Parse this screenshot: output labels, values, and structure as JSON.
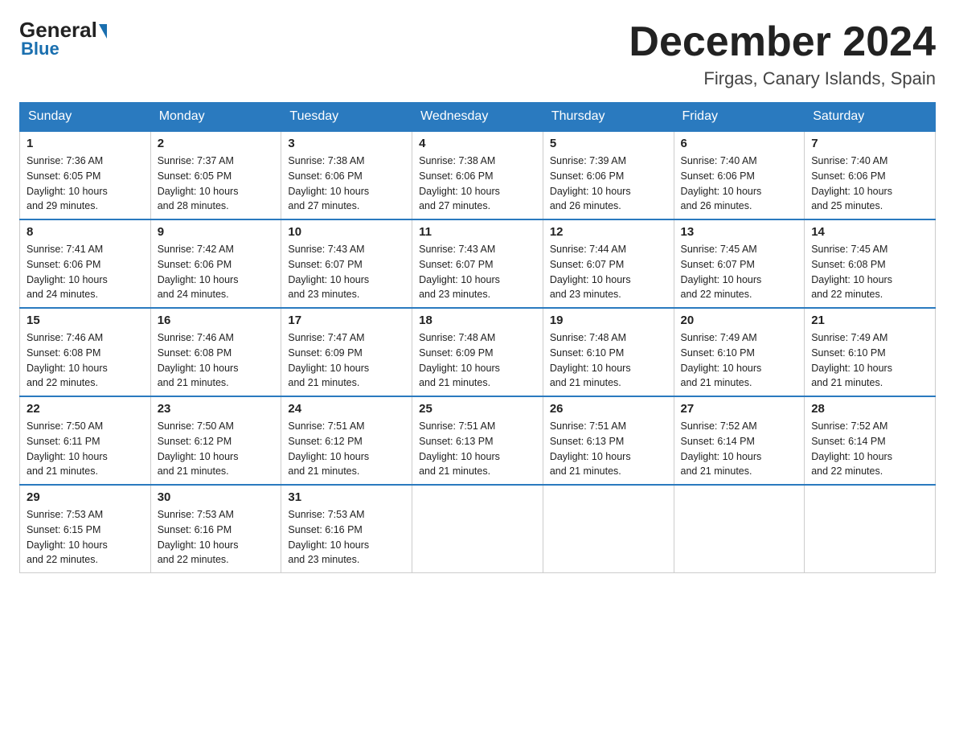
{
  "header": {
    "logo": {
      "general": "General",
      "blue": "Blue"
    },
    "title": "December 2024",
    "location": "Firgas, Canary Islands, Spain"
  },
  "days_of_week": [
    "Sunday",
    "Monday",
    "Tuesday",
    "Wednesday",
    "Thursday",
    "Friday",
    "Saturday"
  ],
  "weeks": [
    [
      {
        "day": "1",
        "sunrise": "7:36 AM",
        "sunset": "6:05 PM",
        "daylight": "10 hours and 29 minutes."
      },
      {
        "day": "2",
        "sunrise": "7:37 AM",
        "sunset": "6:05 PM",
        "daylight": "10 hours and 28 minutes."
      },
      {
        "day": "3",
        "sunrise": "7:38 AM",
        "sunset": "6:06 PM",
        "daylight": "10 hours and 27 minutes."
      },
      {
        "day": "4",
        "sunrise": "7:38 AM",
        "sunset": "6:06 PM",
        "daylight": "10 hours and 27 minutes."
      },
      {
        "day": "5",
        "sunrise": "7:39 AM",
        "sunset": "6:06 PM",
        "daylight": "10 hours and 26 minutes."
      },
      {
        "day": "6",
        "sunrise": "7:40 AM",
        "sunset": "6:06 PM",
        "daylight": "10 hours and 26 minutes."
      },
      {
        "day": "7",
        "sunrise": "7:40 AM",
        "sunset": "6:06 PM",
        "daylight": "10 hours and 25 minutes."
      }
    ],
    [
      {
        "day": "8",
        "sunrise": "7:41 AM",
        "sunset": "6:06 PM",
        "daylight": "10 hours and 24 minutes."
      },
      {
        "day": "9",
        "sunrise": "7:42 AM",
        "sunset": "6:06 PM",
        "daylight": "10 hours and 24 minutes."
      },
      {
        "day": "10",
        "sunrise": "7:43 AM",
        "sunset": "6:07 PM",
        "daylight": "10 hours and 23 minutes."
      },
      {
        "day": "11",
        "sunrise": "7:43 AM",
        "sunset": "6:07 PM",
        "daylight": "10 hours and 23 minutes."
      },
      {
        "day": "12",
        "sunrise": "7:44 AM",
        "sunset": "6:07 PM",
        "daylight": "10 hours and 23 minutes."
      },
      {
        "day": "13",
        "sunrise": "7:45 AM",
        "sunset": "6:07 PM",
        "daylight": "10 hours and 22 minutes."
      },
      {
        "day": "14",
        "sunrise": "7:45 AM",
        "sunset": "6:08 PM",
        "daylight": "10 hours and 22 minutes."
      }
    ],
    [
      {
        "day": "15",
        "sunrise": "7:46 AM",
        "sunset": "6:08 PM",
        "daylight": "10 hours and 22 minutes."
      },
      {
        "day": "16",
        "sunrise": "7:46 AM",
        "sunset": "6:08 PM",
        "daylight": "10 hours and 21 minutes."
      },
      {
        "day": "17",
        "sunrise": "7:47 AM",
        "sunset": "6:09 PM",
        "daylight": "10 hours and 21 minutes."
      },
      {
        "day": "18",
        "sunrise": "7:48 AM",
        "sunset": "6:09 PM",
        "daylight": "10 hours and 21 minutes."
      },
      {
        "day": "19",
        "sunrise": "7:48 AM",
        "sunset": "6:10 PM",
        "daylight": "10 hours and 21 minutes."
      },
      {
        "day": "20",
        "sunrise": "7:49 AM",
        "sunset": "6:10 PM",
        "daylight": "10 hours and 21 minutes."
      },
      {
        "day": "21",
        "sunrise": "7:49 AM",
        "sunset": "6:10 PM",
        "daylight": "10 hours and 21 minutes."
      }
    ],
    [
      {
        "day": "22",
        "sunrise": "7:50 AM",
        "sunset": "6:11 PM",
        "daylight": "10 hours and 21 minutes."
      },
      {
        "day": "23",
        "sunrise": "7:50 AM",
        "sunset": "6:12 PM",
        "daylight": "10 hours and 21 minutes."
      },
      {
        "day": "24",
        "sunrise": "7:51 AM",
        "sunset": "6:12 PM",
        "daylight": "10 hours and 21 minutes."
      },
      {
        "day": "25",
        "sunrise": "7:51 AM",
        "sunset": "6:13 PM",
        "daylight": "10 hours and 21 minutes."
      },
      {
        "day": "26",
        "sunrise": "7:51 AM",
        "sunset": "6:13 PM",
        "daylight": "10 hours and 21 minutes."
      },
      {
        "day": "27",
        "sunrise": "7:52 AM",
        "sunset": "6:14 PM",
        "daylight": "10 hours and 21 minutes."
      },
      {
        "day": "28",
        "sunrise": "7:52 AM",
        "sunset": "6:14 PM",
        "daylight": "10 hours and 22 minutes."
      }
    ],
    [
      {
        "day": "29",
        "sunrise": "7:53 AM",
        "sunset": "6:15 PM",
        "daylight": "10 hours and 22 minutes."
      },
      {
        "day": "30",
        "sunrise": "7:53 AM",
        "sunset": "6:16 PM",
        "daylight": "10 hours and 22 minutes."
      },
      {
        "day": "31",
        "sunrise": "7:53 AM",
        "sunset": "6:16 PM",
        "daylight": "10 hours and 23 minutes."
      },
      null,
      null,
      null,
      null
    ]
  ],
  "labels": {
    "sunrise": "Sunrise:",
    "sunset": "Sunset:",
    "daylight": "Daylight:"
  }
}
